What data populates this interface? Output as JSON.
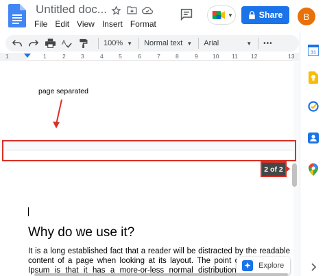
{
  "titlebar": {
    "doc_title": "Untitled doc...",
    "menu": [
      "File",
      "Edit",
      "View",
      "Insert",
      "Format"
    ],
    "share_label": "Share",
    "avatar_initial": "B"
  },
  "toolbar": {
    "zoom": "100%",
    "style": "Normal text",
    "font": "Arial",
    "more": "•••"
  },
  "ruler": {
    "numbers": [
      "1",
      "1",
      "2",
      "3",
      "4",
      "5",
      "6",
      "7",
      "8",
      "9",
      "10",
      "11",
      "12",
      "13"
    ]
  },
  "document": {
    "annotation": "page separated",
    "page_indicator": "2 of 2",
    "heading": "Why do we use it?",
    "paragraph": "It is a long established fact that a reader will be distracted by the readable content of a page when looking at its layout. The point of using Lorem Ipsum is that it has a more-or-less normal distribution of letters, as opposed to using 'Content here, content here', making it look like readable English."
  },
  "explore": {
    "label": "Explore"
  },
  "side_panel": {
    "icons": [
      "calendar-icon",
      "keep-icon",
      "tasks-icon",
      "contacts-icon",
      "maps-icon"
    ],
    "calendar_day": "31"
  },
  "colors": {
    "accent": "#1a73e8",
    "annotation_red": "#d93025",
    "avatar": "#e8710a",
    "badge": "#444746"
  }
}
